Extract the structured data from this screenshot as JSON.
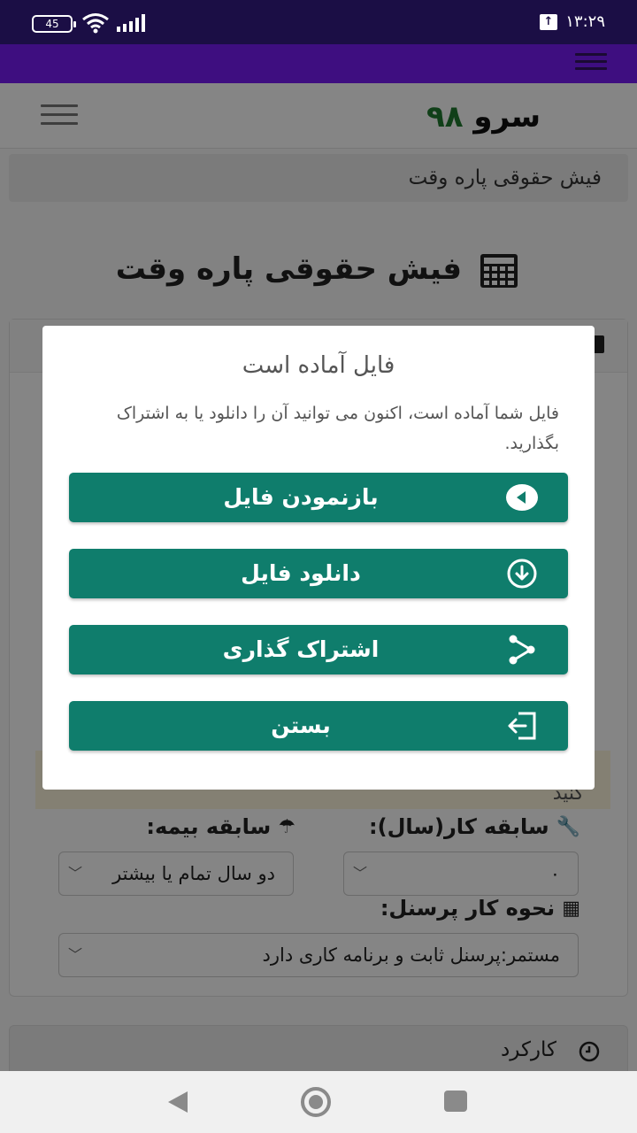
{
  "status_bar": {
    "time": "۱۳:۲۹",
    "battery": "45"
  },
  "site": {
    "logo_word": "سرو",
    "logo_number": "۹۸"
  },
  "breadcrumb": "فیش حقوقی پاره وقت",
  "page_title": "فیش حقوقی پاره وقت",
  "form": {
    "alert_tail": "کنید",
    "work_history_label": "سابقه کار(سال):",
    "work_history_value": "۰",
    "insurance_label": "سابقه بیمه:",
    "insurance_value": "دو سال تمام یا بیشتر",
    "personnel_mode_label": "نحوه کار پرسنل:",
    "personnel_mode_value": "مستمر:پرسنل ثابت و برنامه کاری دارد"
  },
  "card2_title": "کارکرد",
  "modal": {
    "title": "فایل آماده است",
    "body": "فایل شما آماده است، اکنون می توانید آن را دانلود یا به اشتراک بگذارید.",
    "buttons": {
      "open": "بازنمودن فایل",
      "download": "دانلود فایل",
      "share": "اشتراک گذاری",
      "close": "بستن"
    }
  },
  "colors": {
    "status_bar": "#1b0e45",
    "app_bar": "#3e0e80",
    "modal_button": "#0f7d6c",
    "logo_number": "#1f7a2e"
  },
  "icons": {
    "open": "play-circle-icon",
    "download": "download-circle-icon",
    "share": "share-nodes-icon",
    "close": "sign-in-box-icon"
  }
}
